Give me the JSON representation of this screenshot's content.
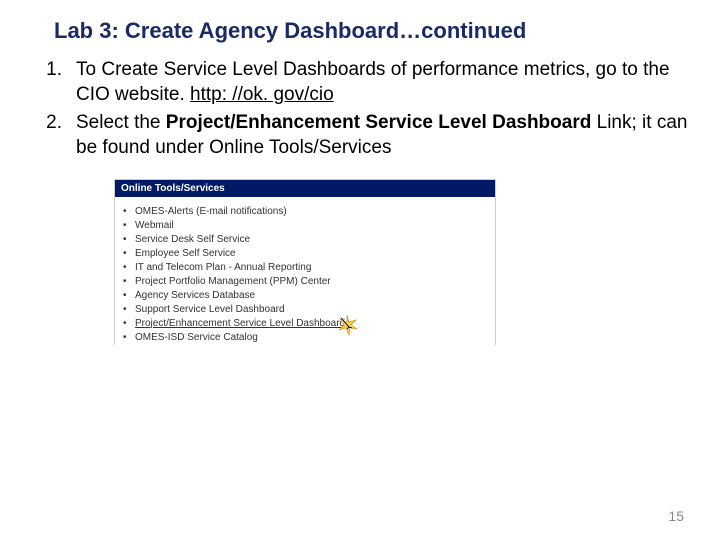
{
  "title": "Lab 3: Create Agency Dashboard…continued",
  "steps": {
    "s1_num": "1.",
    "s1_a": "To Create Service Level Dashboards of performance metrics, go to the CIO website. ",
    "s1_link": "http: //ok. gov/cio",
    "s2_num": "2.",
    "s2_a": "Select the ",
    "s2_bold": "Project/Enhancement Service Level Dashboard",
    "s2_b": " Link; it can be found under Online Tools/Services"
  },
  "panel": {
    "header": "Online Tools/Services",
    "items": [
      "OMES-Alerts (E-mail notifications)",
      "Webmail",
      "Service Desk Self Service",
      "Employee Self Service",
      "IT and Telecom Plan - Annual Reporting",
      "Project Portfolio Management (PPM) Center",
      "Agency Services Database",
      "Support Service Level Dashboard",
      "Project/Enhancement Service Level Dashboard",
      "OMES-ISD Service Catalog"
    ]
  },
  "pagenum": "15"
}
